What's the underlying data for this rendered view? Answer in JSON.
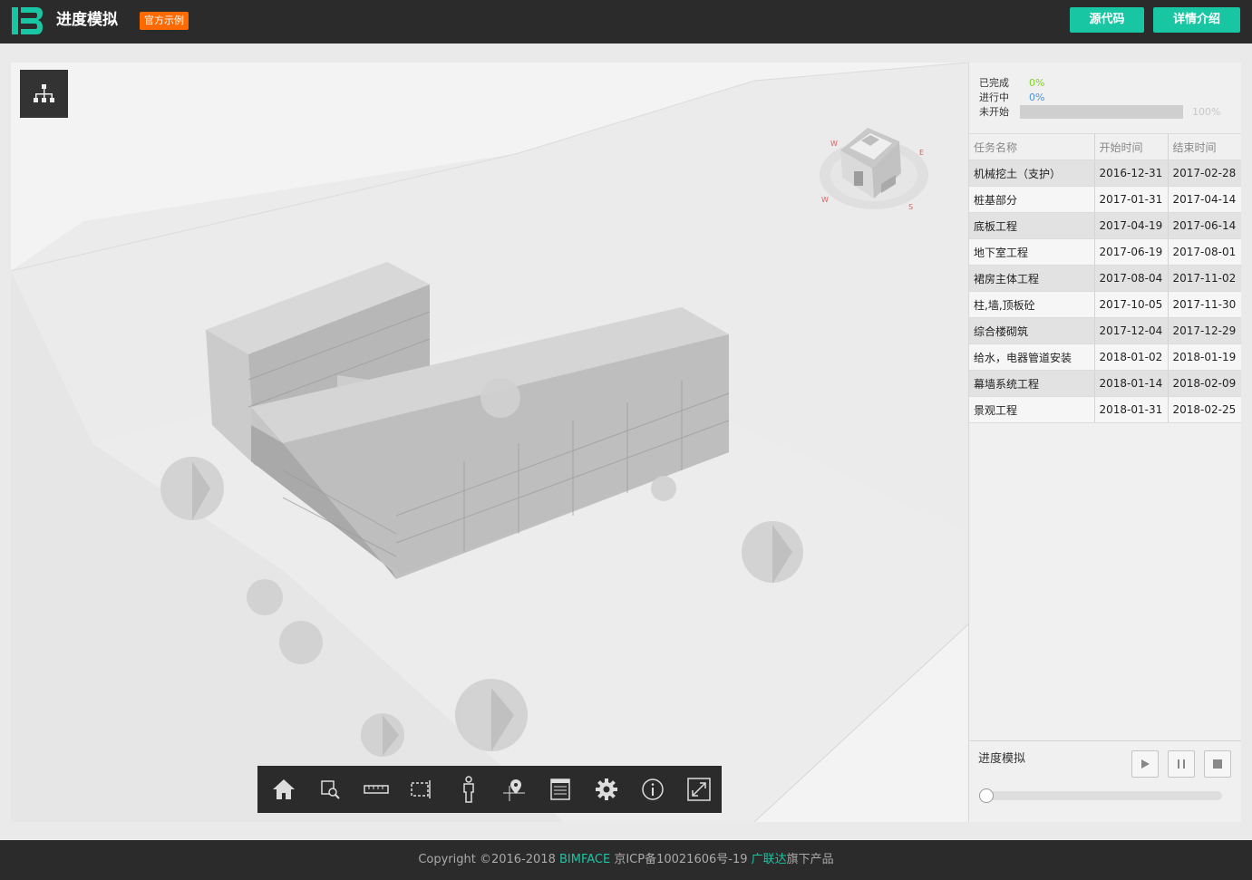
{
  "header": {
    "title": "进度模拟",
    "badge": "官方示例",
    "btn_source": "源代码",
    "btn_detail": "详情介绍",
    "logo_icon": "bimface-logo-icon"
  },
  "viewer": {
    "tree_icon": "model-tree-icon",
    "viewcube_icon": "viewcube-house-icon",
    "toolbar": [
      {
        "name": "home-icon"
      },
      {
        "name": "zoom-box-icon"
      },
      {
        "name": "measure-ruler-icon"
      },
      {
        "name": "section-box-icon"
      },
      {
        "name": "walk-person-icon"
      },
      {
        "name": "map-pin-icon"
      },
      {
        "name": "properties-list-icon"
      },
      {
        "name": "settings-gear-icon"
      },
      {
        "name": "info-icon"
      },
      {
        "name": "fullscreen-icon"
      }
    ]
  },
  "progress": {
    "done_label": "已完成",
    "done_pct": "0%",
    "doing_label": "进行中",
    "doing_pct": "0%",
    "todo_label": "未开始",
    "todo_pct": "100%",
    "colors": {
      "done": "#7ed321",
      "doing": "#4a90e2",
      "todo": "#cfcfcf"
    }
  },
  "table": {
    "headers": [
      "任务名称",
      "开始时间",
      "结束时间"
    ],
    "rows": [
      [
        "机械挖土（支护）",
        "2016-12-31",
        "2017-02-28"
      ],
      [
        "桩基部分",
        "2017-01-31",
        "2017-04-14"
      ],
      [
        "底板工程",
        "2017-04-19",
        "2017-06-14"
      ],
      [
        "地下室工程",
        "2017-06-19",
        "2017-08-01"
      ],
      [
        "裙房主体工程",
        "2017-08-04",
        "2017-11-02"
      ],
      [
        "柱,墙,顶板砼",
        "2017-10-05",
        "2017-11-30"
      ],
      [
        "综合楼砌筑",
        "2017-12-04",
        "2017-12-29"
      ],
      [
        "给水，电器管道安装",
        "2018-01-02",
        "2018-01-19"
      ],
      [
        "幕墙系统工程",
        "2018-01-14",
        "2018-02-09"
      ],
      [
        "景观工程",
        "2018-01-31",
        "2018-02-25"
      ]
    ]
  },
  "simulation": {
    "label": "进度模拟",
    "play_icon": "play-icon",
    "pause_icon": "pause-icon",
    "stop_icon": "stop-icon",
    "slider_value": 0
  },
  "footer": {
    "prefix": "Copyright ©2016-2018 ",
    "brand": "BIMFACE",
    "icp": " 京ICP备10021606号-19 ",
    "company": "广联达",
    "suffix": "旗下产品",
    "accent": "#19c6a3"
  }
}
